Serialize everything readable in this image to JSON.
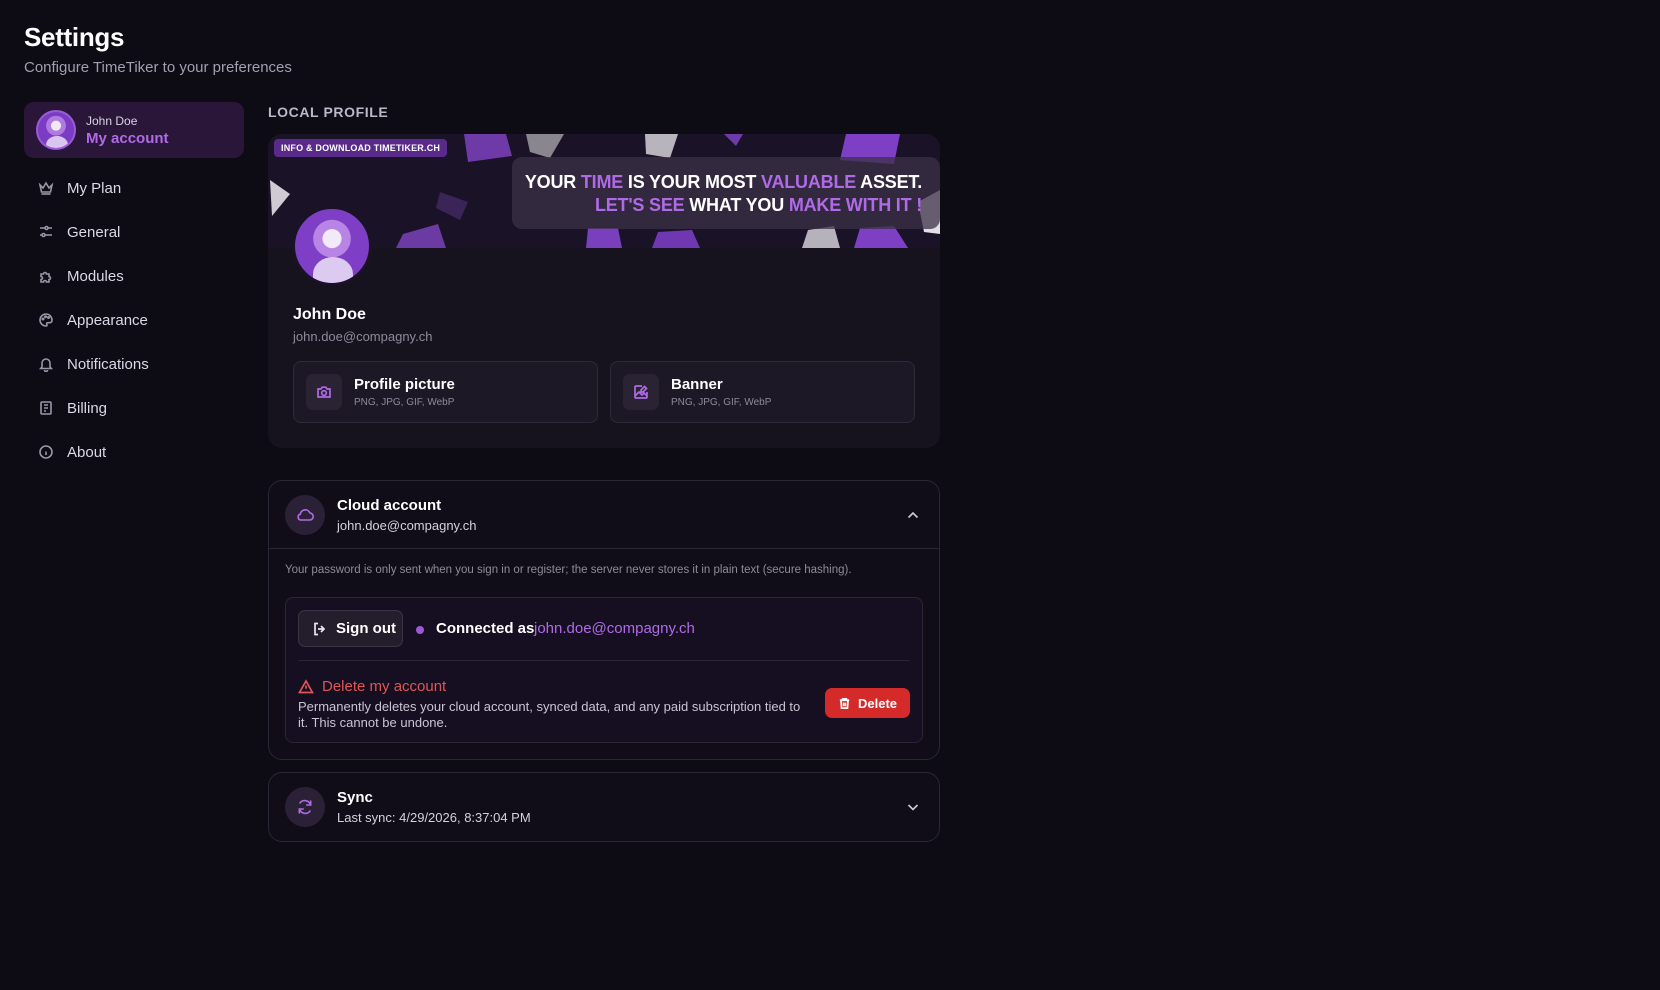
{
  "header": {
    "title": "Settings",
    "subtitle": "Configure TimeTiker to your preferences"
  },
  "sidebar": {
    "account": {
      "name": "John Doe",
      "label": "My account"
    },
    "items": [
      {
        "label": "My Plan",
        "icon": "crown-icon"
      },
      {
        "label": "General",
        "icon": "sliders-icon"
      },
      {
        "label": "Modules",
        "icon": "puzzle-icon"
      },
      {
        "label": "Appearance",
        "icon": "palette-icon"
      },
      {
        "label": "Notifications",
        "icon": "bell-icon"
      },
      {
        "label": "Billing",
        "icon": "receipt-icon"
      },
      {
        "label": "About",
        "icon": "info-icon"
      }
    ]
  },
  "local_profile": {
    "section_label": "LOCAL PROFILE",
    "banner_tag": "INFO & DOWNLOAD TIMETIKER.CH",
    "banner_quote": {
      "line1": [
        "YOUR ",
        "TIME",
        " IS YOUR MOST ",
        "VALUABLE",
        " ASSET."
      ],
      "line2": [
        "LET'S SEE",
        " WHAT YOU ",
        "MAKE WITH IT !"
      ]
    },
    "name": "John Doe",
    "email": "john.doe@compagny.ch",
    "profile_picture": {
      "title": "Profile picture",
      "formats": "PNG, JPG, GIF, WebP"
    },
    "banner": {
      "title": "Banner",
      "formats": "PNG, JPG, GIF, WebP"
    }
  },
  "cloud_account": {
    "title": "Cloud account",
    "email": "john.doe@compagny.ch",
    "password_note": "Your password is only sent when you sign in or register; the server never stores it in plain text (secure hashing).",
    "sign_out_label": "Sign out",
    "connected_label": "Connected as",
    "connected_email": "john.doe@compagny.ch",
    "delete_title": "Delete my account",
    "delete_description": "Permanently deletes your cloud account, synced data, and any paid subscription tied to it. This cannot be undone.",
    "delete_button": "Delete"
  },
  "sync": {
    "title": "Sync",
    "last_sync": "Last sync: 4/29/2026, 8:37:04 PM"
  },
  "colors": {
    "accent": "#b06ae8",
    "danger": "#d42a2a",
    "background": "#0d0b14"
  }
}
